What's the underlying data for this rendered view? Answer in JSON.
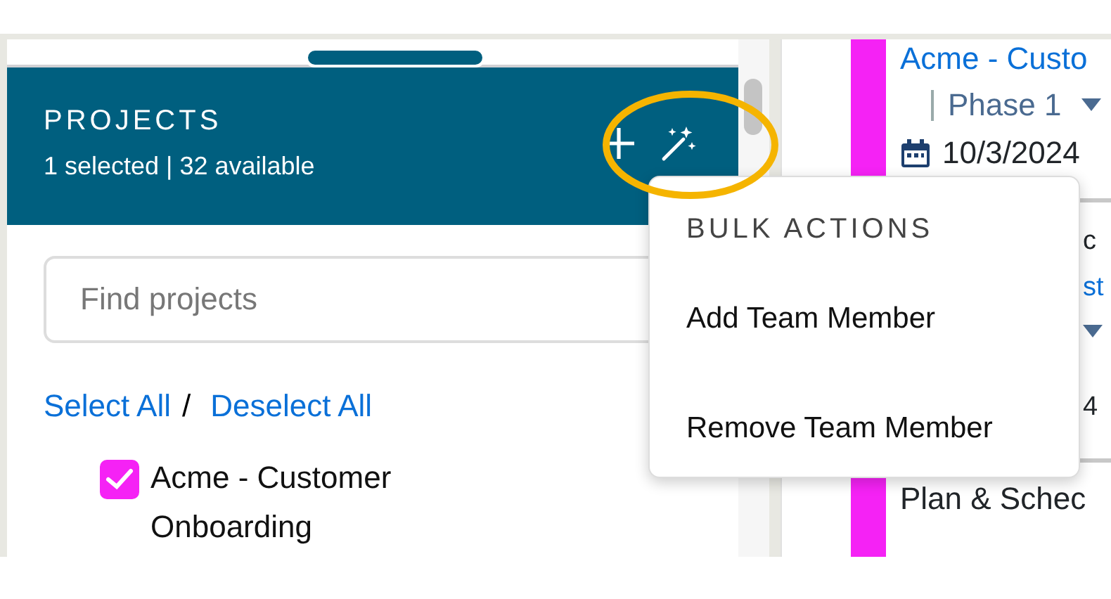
{
  "projects_panel": {
    "title": "PROJECTS",
    "subtitle": "1 selected | 32 available",
    "search": {
      "placeholder": "Find projects"
    },
    "select_all": "Select All",
    "separator": "/",
    "deselect_all": "Deselect All",
    "items": [
      {
        "label": "Acme - Customer Onboarding",
        "checked": true,
        "color": "#f522f5"
      }
    ]
  },
  "bulk_menu": {
    "header": "BULK ACTIONS",
    "items": [
      "Add Team Member",
      "Remove Team Member"
    ]
  },
  "task_cards": [
    {
      "title": "Acme - Custo",
      "phase": "Phase 1",
      "date": "10/3/2024",
      "color": "#f522f5"
    },
    {
      "title": "c",
      "project": "st",
      "date": "4"
    },
    {
      "title": "Plan & Schec",
      "color": "#f522f5"
    }
  ]
}
